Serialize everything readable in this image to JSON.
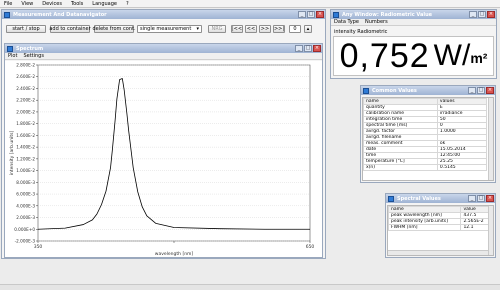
{
  "menu": [
    "File",
    "View",
    "Devices",
    "Tools",
    "Language",
    "?"
  ],
  "main_window": {
    "title": "Measurement And Datanavigator",
    "toolbar": {
      "start_stop": "start / stop",
      "add_to_container": "add to container",
      "delete_from_cont": "delete from cont.",
      "measurement_select": "single measurement",
      "ndtab": "NRG",
      "nav": [
        "|<<",
        "<<",
        ">>",
        ">>|"
      ],
      "counter": "0"
    }
  },
  "spectrum": {
    "title": "Spectrum",
    "tabs": [
      "Plot",
      "Settings"
    ],
    "colors": {
      "curve": "#000000",
      "grid": "#cfcfcf"
    },
    "chart_data": {
      "type": "line",
      "xlabel": "wavelength [nm]",
      "ylabel": "intensity [arb.units]",
      "x_ticks": [
        "350",
        "",
        "650"
      ],
      "y_ticks": [
        "2.800E-2",
        "2.600E-2",
        "2.400E-2",
        "2.200E-2",
        "2.000E-2",
        "1.800E-2",
        "1.600E-2",
        "1.400E-2",
        "1.200E-2",
        "1.000E-2",
        "8.000E-3",
        "6.000E-3",
        "4.000E-3",
        "2.000E-3",
        "0.000E+0",
        "-2.000E-3"
      ],
      "xlim": [
        350,
        650
      ],
      "ylim": [
        -0.002,
        0.028
      ],
      "series": [
        {
          "x": [
            350,
            380,
            400,
            410,
            415,
            420,
            425,
            430,
            432,
            435,
            437,
            440,
            443,
            445,
            448,
            450,
            455,
            460,
            465,
            470,
            480,
            500,
            550,
            600,
            650
          ],
          "y": [
            0,
            0.0002,
            0.0008,
            0.0016,
            0.0026,
            0.0042,
            0.0065,
            0.0105,
            0.0135,
            0.0185,
            0.0222,
            0.0255,
            0.0257,
            0.0238,
            0.0198,
            0.0168,
            0.0105,
            0.0064,
            0.0038,
            0.0023,
            0.001,
            0.0003,
            0.0001,
            0,
            0
          ]
        }
      ]
    }
  },
  "radiometric": {
    "title": "Any Window: Radiometric Value",
    "tabs": [
      "Data Type",
      "Numbers"
    ],
    "subheader": "intensity Radiometric",
    "value": "0,752",
    "unit_main": "W/",
    "unit_sub": "m²"
  },
  "common_values": {
    "title": "Common Values",
    "header": [
      "name",
      "values"
    ],
    "rows": [
      [
        "quantity",
        "E"
      ],
      [
        "calibration name",
        "irradiance"
      ],
      [
        "integration time",
        "50"
      ],
      [
        "spectral time [ms]",
        "0"
      ],
      [
        "avrgd. factor",
        "1.0000"
      ],
      [
        "avrgd. filename",
        ""
      ],
      [
        "meas. comment",
        "ok"
      ],
      [
        "date",
        "15.05.2014"
      ],
      [
        "time",
        "12:45:00"
      ],
      [
        "temperature [°C]",
        "25.25"
      ],
      [
        "x(n)",
        "0.5145"
      ]
    ]
  },
  "spectral_values": {
    "title": "Spectral Values",
    "header": [
      "name",
      "value"
    ],
    "rows": [
      [
        "peak wavelength [nm]",
        "437.5"
      ],
      [
        "peak intensity [arb.units]",
        "2.565E-2"
      ],
      [
        "FWHM [nm]",
        "12.1"
      ]
    ]
  }
}
